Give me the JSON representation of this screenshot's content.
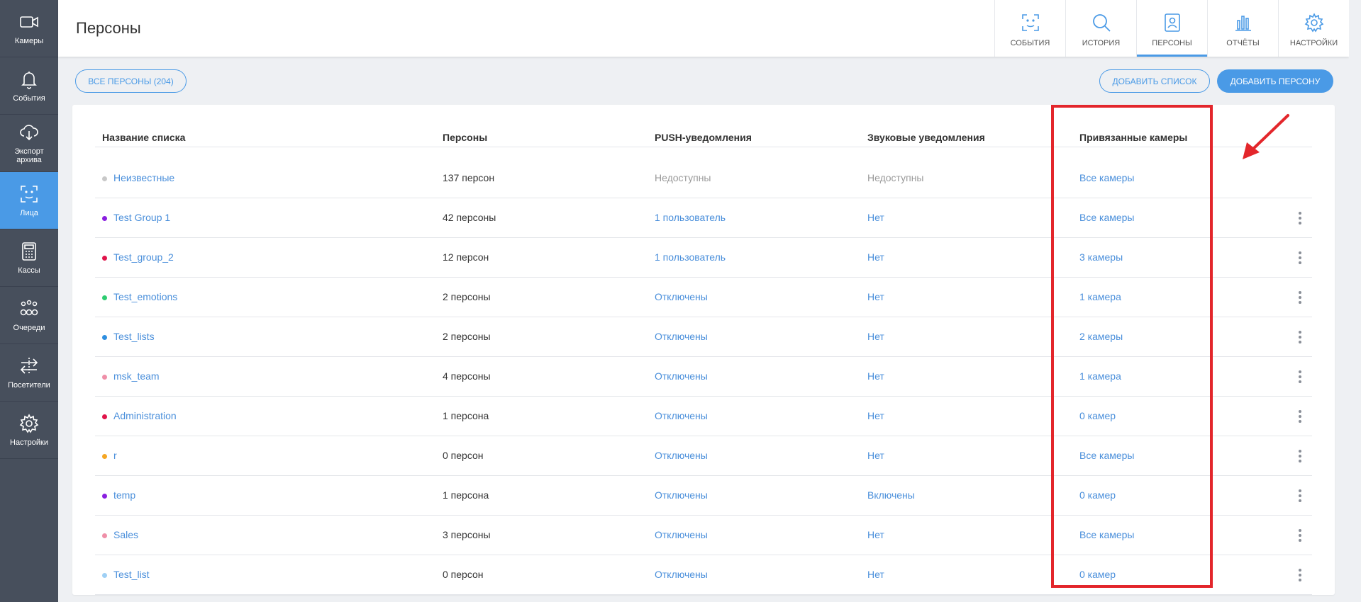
{
  "sidebar": {
    "items": [
      {
        "label": "Камеры",
        "icon": "video-camera-icon",
        "active": false
      },
      {
        "label": "События",
        "icon": "bell-icon",
        "active": false
      },
      {
        "label": "Экспорт архива",
        "icon": "cloud-download-icon",
        "active": false
      },
      {
        "label": "Лица",
        "icon": "face-scan-icon",
        "active": true
      },
      {
        "label": "Кассы",
        "icon": "cash-register-icon",
        "active": false
      },
      {
        "label": "Очереди",
        "icon": "queue-people-icon",
        "active": false
      },
      {
        "label": "Посетители",
        "icon": "visitors-arrows-icon",
        "active": false
      },
      {
        "label": "Настройки",
        "icon": "gear-icon",
        "active": false
      }
    ]
  },
  "header": {
    "title": "Персоны",
    "tabs": [
      {
        "label": "СОБЫТИЯ",
        "icon": "face-scan-icon",
        "active": false
      },
      {
        "label": "ИСТОРИЯ",
        "icon": "search-icon",
        "active": false
      },
      {
        "label": "ПЕРСОНЫ",
        "icon": "person-card-icon",
        "active": true
      },
      {
        "label": "ОТЧЁТЫ",
        "icon": "bar-chart-icon",
        "active": false
      },
      {
        "label": "НАСТРОЙКИ",
        "icon": "gear-icon",
        "active": false
      }
    ]
  },
  "actions": {
    "all_persons": "ВСЕ ПЕРСОНЫ (204)",
    "add_list": "ДОБАВИТЬ СПИСОК",
    "add_person": "ДОБАВИТЬ ПЕРСОНУ"
  },
  "colors": {
    "accent": "#4a9ae6",
    "rail": "#474f5c",
    "annotation": "#e3262b"
  },
  "table": {
    "columns": [
      "Название списка",
      "Персоны",
      "PUSH-уведомления",
      "Звуковые уведомления",
      "Привязанные камеры"
    ],
    "rows": [
      {
        "name": "Неизвестные",
        "dot": "#c8c8c8",
        "persons": "137 персон",
        "push": "Недоступны",
        "push_muted": true,
        "sound": "Недоступны",
        "sound_muted": true,
        "cameras": "Все камеры",
        "menu": false
      },
      {
        "name": "Test Group 1",
        "dot": "#8a1fe0",
        "persons": "42 персоны",
        "push": "1 пользователь",
        "push_muted": false,
        "sound": "Нет",
        "sound_muted": false,
        "cameras": "Все камеры",
        "menu": true
      },
      {
        "name": "Test_group_2",
        "dot": "#e0144a",
        "persons": "12 персон",
        "push": "1 пользователь",
        "push_muted": false,
        "sound": "Нет",
        "sound_muted": false,
        "cameras": "3 камеры",
        "menu": true
      },
      {
        "name": "Test_emotions",
        "dot": "#2ecc71",
        "persons": "2 персоны",
        "push": "Отключены",
        "push_muted": false,
        "sound": "Нет",
        "sound_muted": false,
        "cameras": "1 камера",
        "menu": true
      },
      {
        "name": "Test_lists",
        "dot": "#2f8fe0",
        "persons": "2 персоны",
        "push": "Отключены",
        "push_muted": false,
        "sound": "Нет",
        "sound_muted": false,
        "cameras": "2 камеры",
        "menu": true
      },
      {
        "name": "msk_team",
        "dot": "#ef8fa8",
        "persons": "4 персоны",
        "push": "Отключены",
        "push_muted": false,
        "sound": "Нет",
        "sound_muted": false,
        "cameras": "1 камера",
        "menu": true
      },
      {
        "name": "Administration",
        "dot": "#e0144a",
        "persons": "1 персона",
        "push": "Отключены",
        "push_muted": false,
        "sound": "Нет",
        "sound_muted": false,
        "cameras": "0 камер",
        "menu": true
      },
      {
        "name": "r",
        "dot": "#f5a623",
        "persons": "0 персон",
        "push": "Отключены",
        "push_muted": false,
        "sound": "Нет",
        "sound_muted": false,
        "cameras": "Все камеры",
        "menu": true
      },
      {
        "name": "temp",
        "dot": "#8a1fe0",
        "persons": "1 персона",
        "push": "Отключены",
        "push_muted": false,
        "sound": "Включены",
        "sound_muted": false,
        "cameras": "0 камер",
        "menu": true
      },
      {
        "name": "Sales",
        "dot": "#ef8fa8",
        "persons": "3 персоны",
        "push": "Отключены",
        "push_muted": false,
        "sound": "Нет",
        "sound_muted": false,
        "cameras": "Все камеры",
        "menu": true
      },
      {
        "name": "Test_list",
        "dot": "#9fd0f5",
        "persons": "0 персон",
        "push": "Отключены",
        "push_muted": false,
        "sound": "Нет",
        "sound_muted": false,
        "cameras": "0 камер",
        "menu": true
      }
    ]
  }
}
